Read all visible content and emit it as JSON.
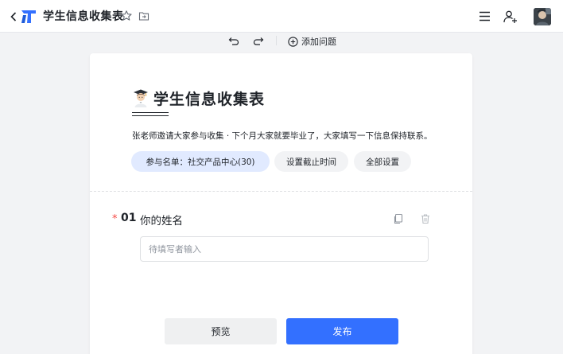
{
  "header": {
    "title": "学生信息收集表",
    "icons": [
      "chevron-left-icon",
      "app-logo-icon",
      "star-icon",
      "folder-icon",
      "menu-icon",
      "add-user-icon",
      "avatar"
    ]
  },
  "toolbar": {
    "add_question_label": "添加问题",
    "icons": [
      "undo-icon",
      "redo-icon",
      "plus-circle-icon"
    ]
  },
  "form": {
    "title": "学生信息收集表",
    "title_emoji": "graduate-emoji",
    "description": "张老师邀请大家参与收集 · 下个月大家就要毕业了，大家填写一下信息保持联系。",
    "pills": {
      "participants": "参与名单：社交产品中心(30)",
      "deadline": "设置截止时间",
      "settings": "全部设置"
    }
  },
  "question": {
    "required_mark": "*",
    "number": "01",
    "title": "你的姓名",
    "placeholder": "待填写者输入",
    "value": ""
  },
  "actions": {
    "preview_label": "预览",
    "publish_label": "发布"
  },
  "colors": {
    "accent": "#3370ff",
    "pill_active": "#e1eaff",
    "required": "#f54a45"
  }
}
